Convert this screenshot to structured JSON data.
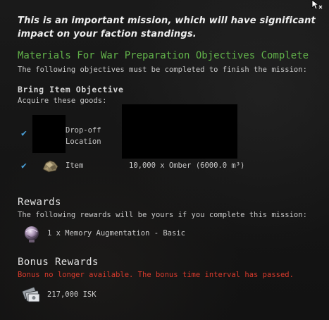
{
  "warning_text": "This is an important mission, which will have significant impact on your faction standings.",
  "warning_line1": "This is an important mission, which will have significant",
  "warning_line2": "impact on your faction standings.",
  "objectives": {
    "title": "Materials For War Preparation Objectives Complete",
    "description": "The following objectives must be completed to finish the mission:"
  },
  "bring_item": {
    "title": "Bring Item Objective",
    "description": "Acquire these goods:",
    "rows": [
      {
        "label_line1": "Drop-off",
        "label_line2": "Location",
        "value": "",
        "icon": "location-thumbnail"
      },
      {
        "label": "Item",
        "value": "10,000 x Omber (6000.0 m³)",
        "icon": "ore-icon"
      }
    ]
  },
  "rewards": {
    "title": "Rewards",
    "description": "The following rewards will be yours if you complete this mission:",
    "items": [
      {
        "text": "1 x Memory Augmentation - Basic",
        "icon": "implant-icon"
      }
    ]
  },
  "bonus_rewards": {
    "title": "Bonus Rewards",
    "status": "Bonus no longer available. The bonus time interval has passed.",
    "items": [
      {
        "text": "217,000 ISK",
        "icon": "isk-icon"
      }
    ]
  },
  "colors": {
    "objective_green": "#62b34a",
    "check_blue": "#4aa0d8",
    "bonus_red": "#d93a2c"
  }
}
